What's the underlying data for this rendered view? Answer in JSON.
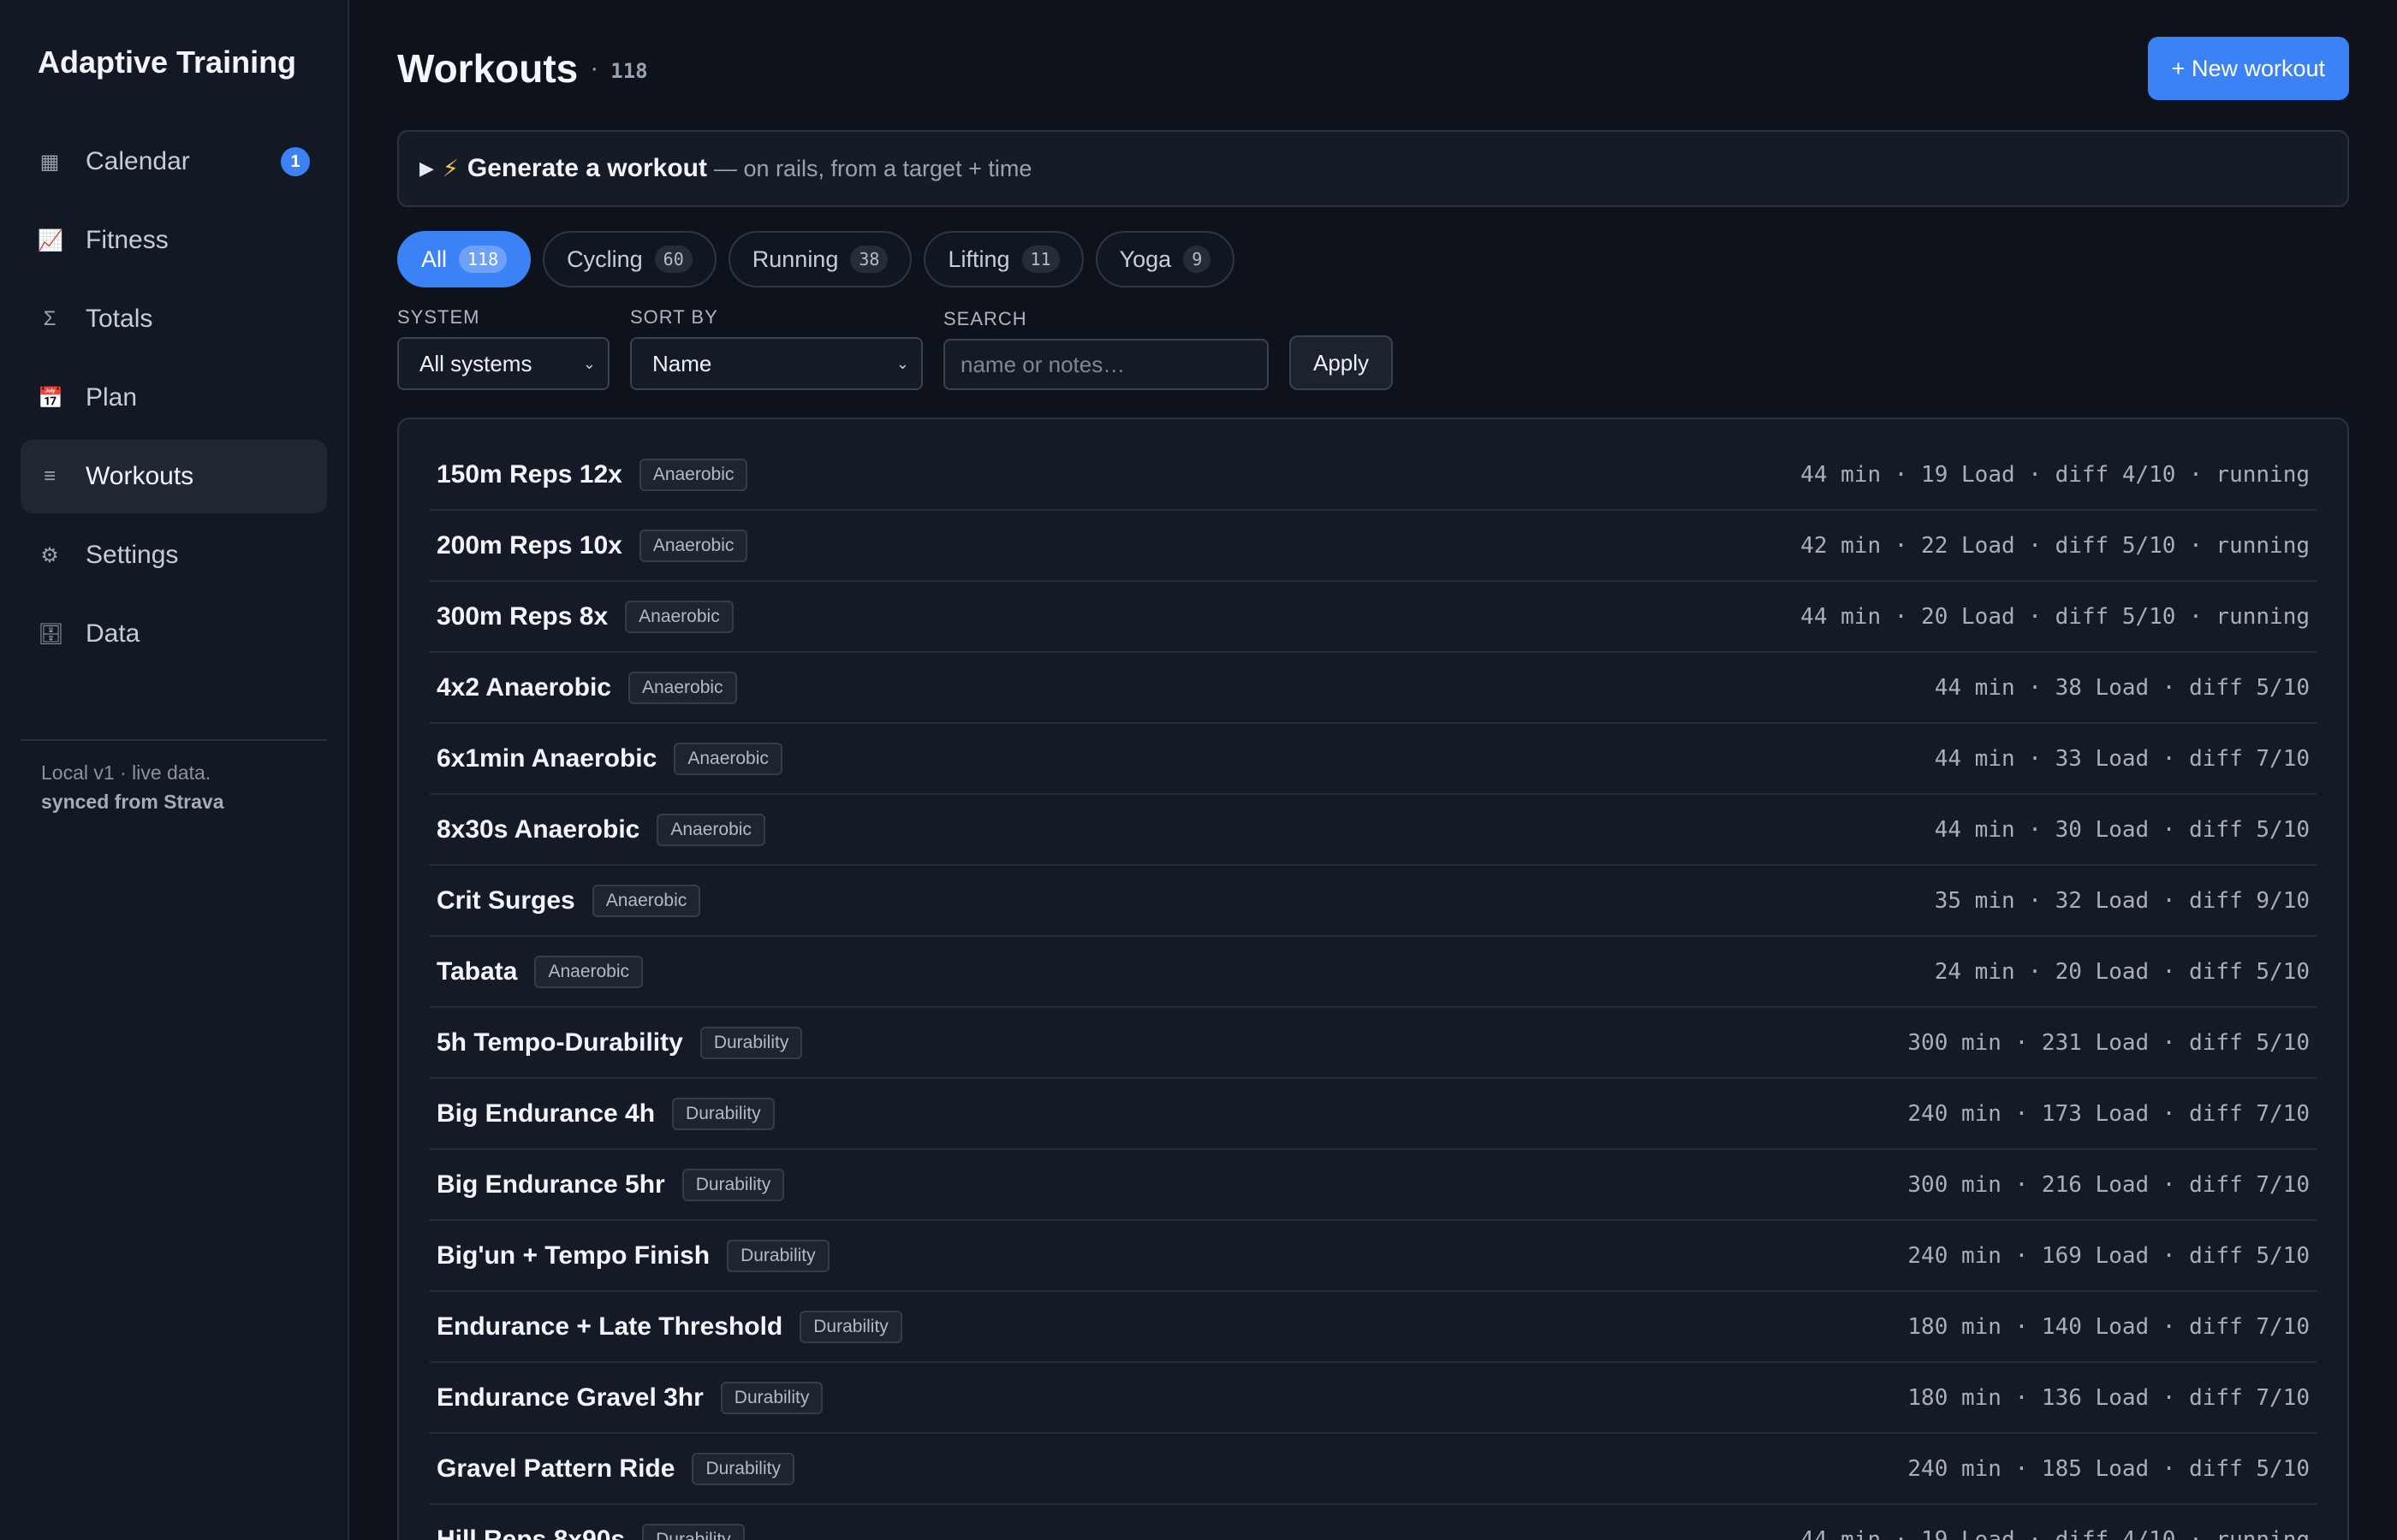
{
  "app": {
    "brand": "Adaptive Training"
  },
  "sidebar": {
    "items": [
      {
        "label": "Calendar",
        "icon": "▦",
        "icon_name": "calendar-icon",
        "badge": "1"
      },
      {
        "label": "Fitness",
        "icon": "📈",
        "icon_name": "chart-icon"
      },
      {
        "label": "Totals",
        "icon": "Σ",
        "icon_name": "sigma-icon"
      },
      {
        "label": "Plan",
        "icon": "📅",
        "icon_name": "plan-icon"
      },
      {
        "label": "Workouts",
        "icon": "≡",
        "icon_name": "list-icon",
        "active": true
      },
      {
        "label": "Settings",
        "icon": "⚙",
        "icon_name": "gear-icon"
      },
      {
        "label": "Data",
        "icon": "🗄",
        "icon_name": "database-icon"
      }
    ],
    "footer_line1": "Local v1 · live data.",
    "footer_line2": "synced from Strava"
  },
  "header": {
    "title": "Workouts",
    "separator": "·",
    "count": "118",
    "new_button": "+ New workout"
  },
  "generator": {
    "caret": "▶",
    "bolt": "⚡",
    "title": "Generate a workout",
    "subtitle": "— on rails, from a target + time"
  },
  "chips": [
    {
      "label": "All",
      "count": "118",
      "active": true
    },
    {
      "label": "Cycling",
      "count": "60"
    },
    {
      "label": "Running",
      "count": "38"
    },
    {
      "label": "Lifting",
      "count": "11"
    },
    {
      "label": "Yoga",
      "count": "9"
    }
  ],
  "filters": {
    "system_label": "SYSTEM",
    "system_value": "All systems",
    "sort_label": "SORT BY",
    "sort_value": "Name",
    "search_label": "SEARCH",
    "search_placeholder": "name or notes…",
    "apply": "Apply"
  },
  "workouts": [
    {
      "name": "150m Reps 12x",
      "tag": "Anaerobic",
      "meta": "44 min · 19 Load · diff 4/10 · running"
    },
    {
      "name": "200m Reps 10x",
      "tag": "Anaerobic",
      "meta": "42 min · 22 Load · diff 5/10 · running"
    },
    {
      "name": "300m Reps 8x",
      "tag": "Anaerobic",
      "meta": "44 min · 20 Load · diff 5/10 · running"
    },
    {
      "name": "4x2 Anaerobic",
      "tag": "Anaerobic",
      "meta": "44 min · 38 Load · diff 5/10"
    },
    {
      "name": "6x1min Anaerobic",
      "tag": "Anaerobic",
      "meta": "44 min · 33 Load · diff 7/10"
    },
    {
      "name": "8x30s Anaerobic",
      "tag": "Anaerobic",
      "meta": "44 min · 30 Load · diff 5/10"
    },
    {
      "name": "Crit Surges",
      "tag": "Anaerobic",
      "meta": "35 min · 32 Load · diff 9/10"
    },
    {
      "name": "Tabata",
      "tag": "Anaerobic",
      "meta": "24 min · 20 Load · diff 5/10"
    },
    {
      "name": "5h Tempo-Durability",
      "tag": "Durability",
      "meta": "300 min · 231 Load · diff 5/10"
    },
    {
      "name": "Big Endurance 4h",
      "tag": "Durability",
      "meta": "240 min · 173 Load · diff 7/10"
    },
    {
      "name": "Big Endurance 5hr",
      "tag": "Durability",
      "meta": "300 min · 216 Load · diff 7/10"
    },
    {
      "name": "Big'un + Tempo Finish",
      "tag": "Durability",
      "meta": "240 min · 169 Load · diff 5/10"
    },
    {
      "name": "Endurance + Late Threshold",
      "tag": "Durability",
      "meta": "180 min · 140 Load · diff 7/10"
    },
    {
      "name": "Endurance Gravel 3hr",
      "tag": "Durability",
      "meta": "180 min · 136 Load · diff 7/10"
    },
    {
      "name": "Gravel Pattern Ride",
      "tag": "Durability",
      "meta": "240 min · 185 Load · diff 5/10"
    },
    {
      "name": "Hill Reps 8x90s",
      "tag": "Durability",
      "meta": "44 min · 19 Load · diff 4/10 · running"
    }
  ]
}
